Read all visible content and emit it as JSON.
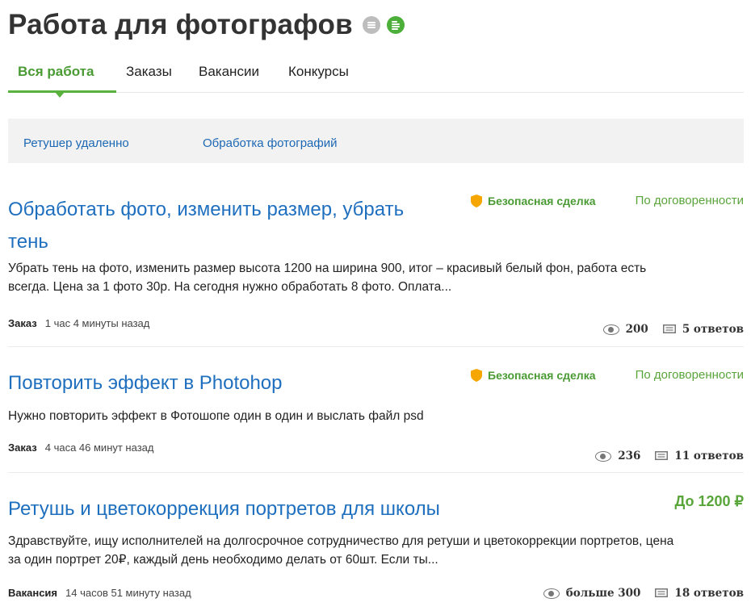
{
  "page_title": "Работа для фотографов",
  "icons": {
    "list_grey": "list-icon",
    "list_green": "feed-icon",
    "accent": "#4caf3a",
    "link": "#1f6fbf"
  },
  "tabs": [
    {
      "label": "Вся работа",
      "active": true
    },
    {
      "label": "Заказы",
      "active": false
    },
    {
      "label": "Вакансии",
      "active": false
    },
    {
      "label": "Конкурсы",
      "active": false
    }
  ],
  "tags": [
    "Ретушер удаленно",
    "Обработка фотографий"
  ],
  "jobs": [
    {
      "title_line1": "Обработать фото, изменить размер, убрать",
      "title_line2": "тень",
      "safe_deal": "Безопасная сделка",
      "price": "По договоренности",
      "description_line1": "Убрать тень на фото,  изменить размер высота 1200 на ширина 900, итог – красивый белый фон, работа есть",
      "description_line2": "всегда. Цена за 1 фото 30р. На сегодня нужно обработать 8 фото. Оплата...",
      "type": "Заказ",
      "time": "1 час 4 минуты назад",
      "views": "200",
      "responses": "5 ответов"
    },
    {
      "title_line1": "Повторить эффект в Photohop",
      "safe_deal": "Безопасная сделка",
      "price": "По договоренности",
      "description_line1": "Нужно повторить эффект в Фотошопе один в один и выслать файл psd",
      "type": "Заказ",
      "time": "4 часа 46 минут назад",
      "views": "236",
      "responses": "11 ответов"
    },
    {
      "title_line1": "Ретушь и цветокоррекция портретов для школы",
      "price": "До 1200 ₽",
      "description_line1": "Здравствуйте, ищу исполнителей на долгосрочное сотрудничество для ретуши и цветокоррекции портретов, цена",
      "description_line2": "за один портрет 20₽, каждый день необходимо делать от 60шт.  Если ты...",
      "type": "Вакансия",
      "time": "14 часов 51 минуту назад",
      "views": "больше 300",
      "responses": "18 ответов"
    }
  ]
}
